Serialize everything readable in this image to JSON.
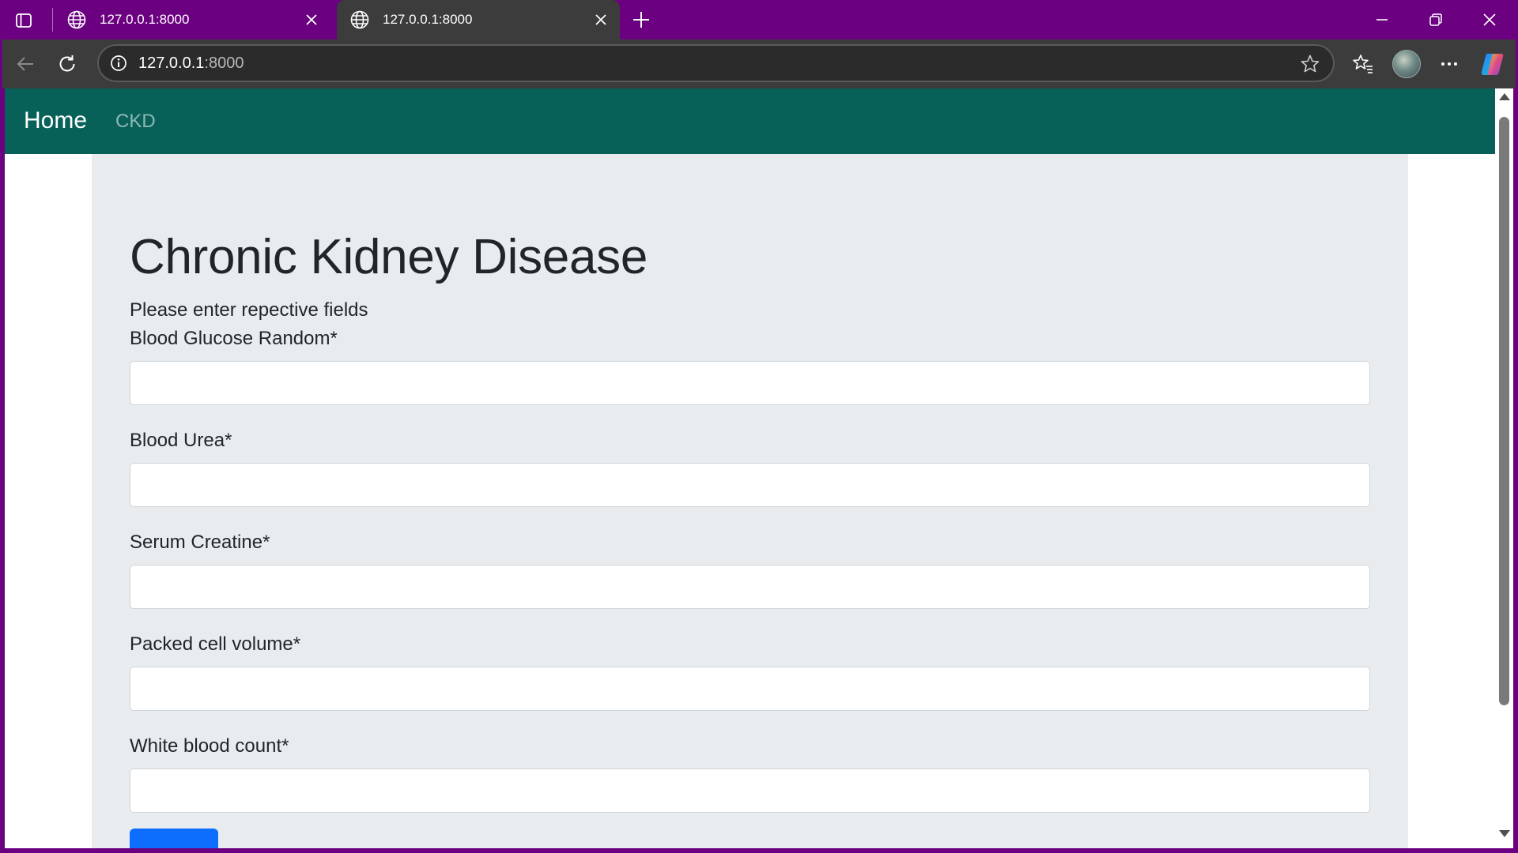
{
  "browser": {
    "tabs": [
      {
        "title": "127.0.0.1:8000",
        "active": false
      },
      {
        "title": "127.0.0.1:8000",
        "active": true
      }
    ],
    "address": {
      "host": "127.0.0.1",
      "port": ":8000"
    },
    "colors": {
      "frame": "#6b0080",
      "toolbar": "#3c3c3c"
    }
  },
  "navbar": {
    "brand": "Home",
    "links": [
      {
        "label": "CKD"
      }
    ],
    "color": "#076158"
  },
  "form": {
    "title": "Chronic Kidney Disease",
    "subtitle": "Please enter repective fields",
    "fields": [
      {
        "label": "Blood Glucose Random*",
        "value": ""
      },
      {
        "label": "Blood Urea*",
        "value": ""
      },
      {
        "label": "Serum Creatine*",
        "value": ""
      },
      {
        "label": "Packed cell volume*",
        "value": ""
      },
      {
        "label": "White blood count*",
        "value": ""
      }
    ],
    "submit_label": "",
    "accent": "#0d6efd"
  }
}
